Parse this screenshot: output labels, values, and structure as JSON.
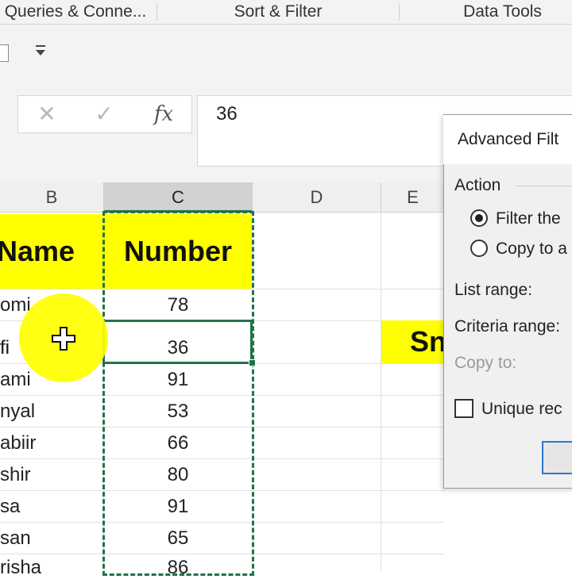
{
  "ribbon": {
    "groups": [
      "Queries & Conne...",
      "Sort & Filter",
      "Data Tools"
    ]
  },
  "formula_bar": {
    "cancel_icon": "✕",
    "enter_icon": "✓",
    "fx_label": "fx",
    "value": "36"
  },
  "columns": [
    "B",
    "C",
    "D",
    "E"
  ],
  "sheet": {
    "header_name": "Name",
    "header_number": "Number",
    "rows": [
      {
        "name": "omi",
        "number": "78"
      },
      {
        "name": "fi",
        "number": "36"
      },
      {
        "name": "ami",
        "number": "91"
      },
      {
        "name": "nyal",
        "number": "53"
      },
      {
        "name": "abiir",
        "number": "66"
      },
      {
        "name": "shir",
        "number": "80"
      },
      {
        "name": "sa",
        "number": "91"
      },
      {
        "name": "san",
        "number": "65"
      },
      {
        "name": "risha",
        "number": "86"
      }
    ],
    "e_cell": "Sn"
  },
  "dialog": {
    "title": "Advanced Filt",
    "action_label": "Action",
    "option_filter": "Filter the",
    "option_copy": "Copy to a",
    "list_range_label": "List range:",
    "criteria_range_label": "Criteria range:",
    "copy_to_label": "Copy to:",
    "unique_label": "Unique rec",
    "selected_option": "filter"
  },
  "colors": {
    "accent": "#217346",
    "highlight": "#ffff00",
    "cursor": "#ffff00"
  }
}
